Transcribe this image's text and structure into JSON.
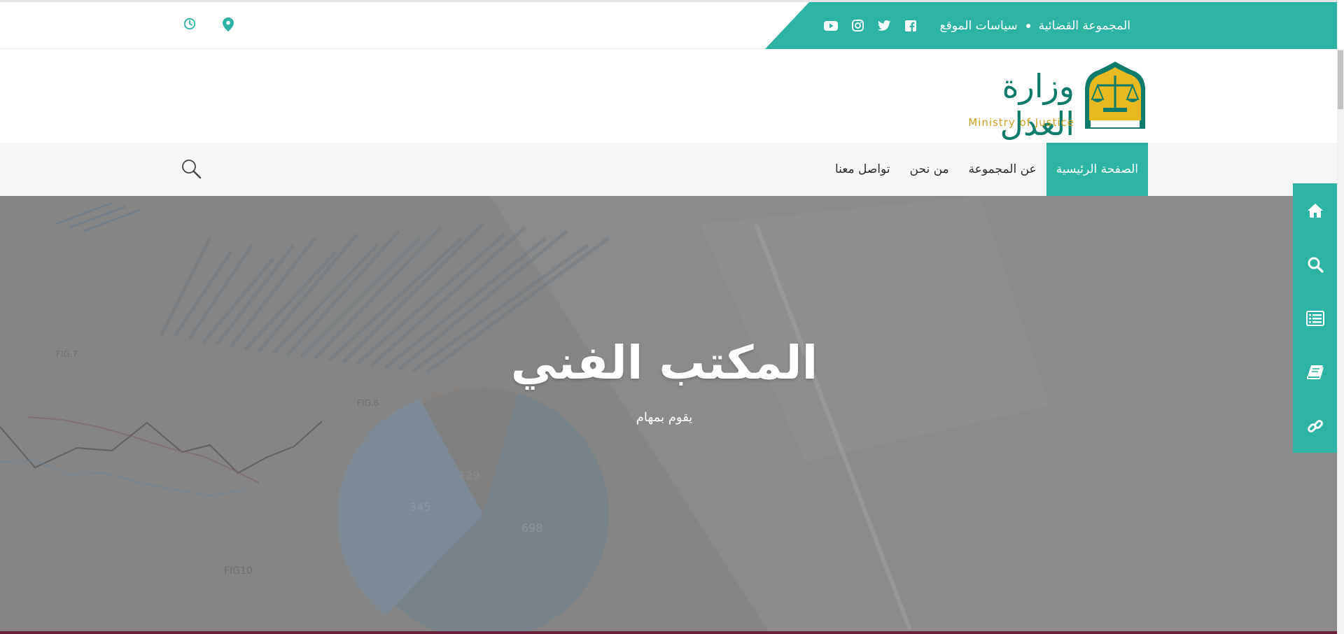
{
  "topbar": {
    "links": [
      "المجموعة القضائية",
      "سياسات الموقع"
    ],
    "socials": [
      "facebook-icon",
      "twitter-icon",
      "instagram-icon",
      "youtube-icon"
    ],
    "left_icons": [
      "location-pin-icon",
      "clock-icon"
    ]
  },
  "logo": {
    "name_ar": "وزارة العدل",
    "name_en": "Ministry of Justice"
  },
  "nav": {
    "items": [
      "الصفحة الرئيسية",
      "عن المجموعة",
      "من نحن",
      "تواصل معنا"
    ],
    "active_index": 0
  },
  "hero": {
    "title": "المكتب الفني",
    "subtitle": "يقوم بمهام"
  },
  "sidebar": {
    "items": [
      "home-icon",
      "search-icon",
      "list-icon",
      "book-icon",
      "link-icon"
    ]
  },
  "colors": {
    "accent": "#2db3a3",
    "logo_green": "#0f7c6b",
    "logo_gold": "#c9a224"
  }
}
